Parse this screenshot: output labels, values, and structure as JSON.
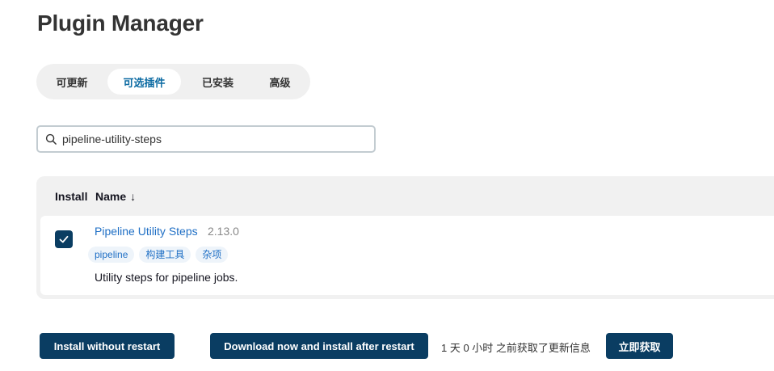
{
  "page_title": "Plugin Manager",
  "tabs": [
    {
      "label": "可更新",
      "active": false
    },
    {
      "label": "可选插件",
      "active": true
    },
    {
      "label": "已安装",
      "active": false
    },
    {
      "label": "高级",
      "active": false
    }
  ],
  "search": {
    "value": "pipeline-utility-steps",
    "icon": "search-icon"
  },
  "table": {
    "headers": {
      "install": "Install",
      "name": "Name",
      "sort_indicator": "↓"
    },
    "rows": [
      {
        "checked": true,
        "name": "Pipeline Utility Steps",
        "version": "2.13.0",
        "tags": [
          "pipeline",
          "构建工具",
          "杂项"
        ],
        "description": "Utility steps for pipeline jobs."
      }
    ]
  },
  "actions": {
    "install_without_restart": "Install without restart",
    "download_and_install_after_restart": "Download now and install after restart",
    "update_status": "1 天 0 小时 之前获取了更新信息",
    "check_now": "立即获取"
  },
  "colors": {
    "accent": "#0a3d62",
    "link": "#1f6fc5",
    "active_tab_text": "#0b6aa2",
    "panel_bg": "#f1f1f1"
  }
}
